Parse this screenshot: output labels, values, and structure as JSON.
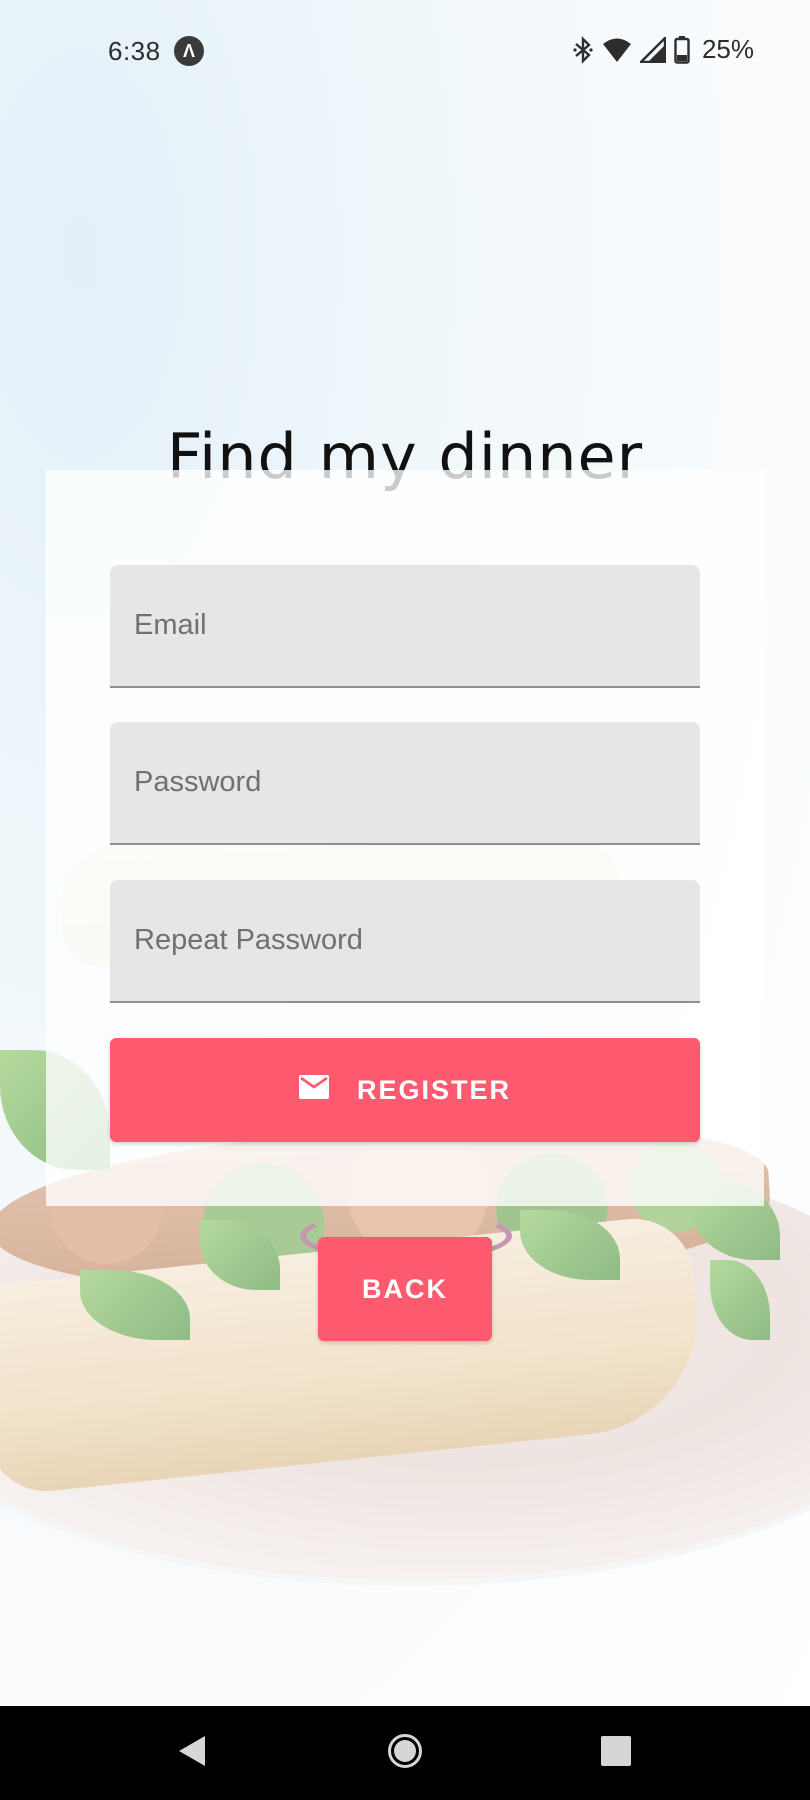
{
  "status_bar": {
    "time": "6:38",
    "app_badge": "Λ",
    "battery_percent": "25%",
    "icons": [
      "bluetooth-icon",
      "wifi-icon",
      "cell-signal-icon",
      "battery-icon"
    ]
  },
  "app": {
    "title": "Find my dinner"
  },
  "form": {
    "email_placeholder": "Email",
    "password_placeholder": "Password",
    "repeat_password_placeholder": "Repeat Password",
    "register_label": "REGISTER",
    "register_icon": "mail-icon"
  },
  "back_label": "BACK",
  "nav_bar": {
    "buttons": [
      "back-icon",
      "home-icon",
      "recents-icon"
    ]
  },
  "colors": {
    "accent": "#fe5a6f",
    "field_bg": "#e6e6e6",
    "nav_bg": "#000000"
  }
}
